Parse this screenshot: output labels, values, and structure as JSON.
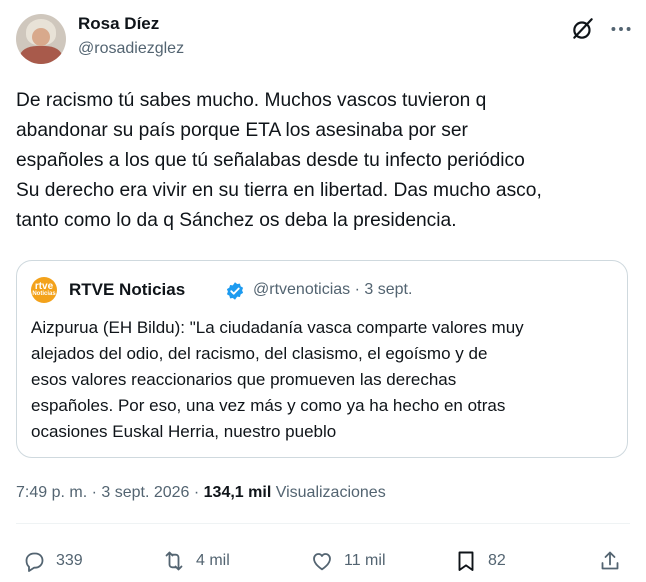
{
  "author": {
    "name": "Rosa Díez",
    "handle": "@rosadiezglez"
  },
  "tweet": {
    "lines": [
      "De racismo tú sabes mucho. Muchos vascos tuvieron q",
      "abandonar su país porque ETA los asesinaba por ser",
      "españoles a los que tú señalabas desde tu infecto periódico",
      "Su derecho era vivir en su tierra en libertad. Das mucho asco,",
      "tanto como lo da q Sánchez os deba la presidencia."
    ]
  },
  "quote": {
    "avatar_text_1": "rtve",
    "avatar_text_2": "Noticias",
    "name": "RTVE Noticias",
    "handle_date": "@rtvenoticias · 3 sept.",
    "lines": [
      "Aizpurua (EH Bildu): \"La ciudadanía vasca comparte valores muy",
      "alejados del odio, del  racismo, del clasismo, el egoísmo y de",
      "esos valores reaccionarios que promueven las derechas",
      "españoles. Por eso, una vez más y como ya ha hecho en otras",
      "ocasiones Euskal Herria, nuestro pueblo"
    ]
  },
  "meta": {
    "time": "7:49 p. m. · 3 sept. 2026 · ",
    "views_count": "134,1 mil",
    "views_label": " Visualizaciones"
  },
  "actions": {
    "replies": "339",
    "retweets": "4 mil",
    "likes": "11 mil",
    "bookmarks": "82"
  },
  "colors": {
    "text": "#0f1419",
    "secondary": "#536471",
    "border": "#cfd9de",
    "verified": "#1d9bf0",
    "rtve": "#f3a21b"
  },
  "icons": [
    "grok-icon",
    "more-icon",
    "verified-icon",
    "reply-icon",
    "retweet-icon",
    "like-icon",
    "bookmark-icon",
    "share-icon"
  ]
}
